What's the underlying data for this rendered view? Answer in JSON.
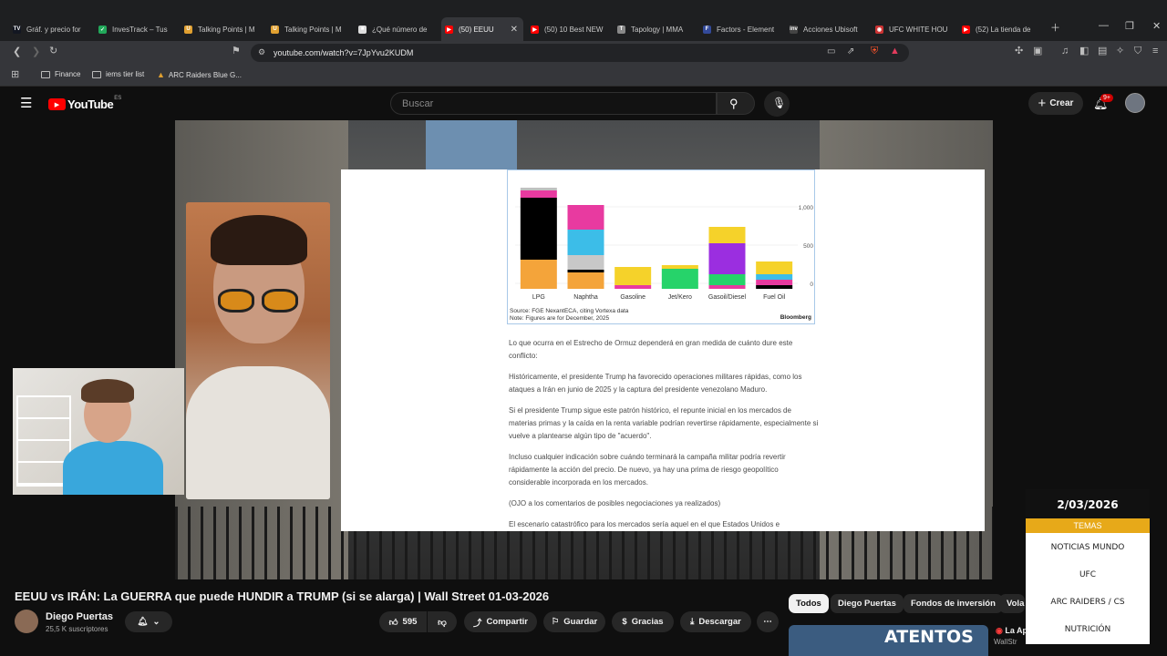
{
  "browser": {
    "tabs": [
      {
        "label": "Gráf. y precio for",
        "color": "#131722",
        "glyph": "TV"
      },
      {
        "label": "InvesTrack – Tus",
        "color": "#22a85a",
        "glyph": "✓"
      },
      {
        "label": "Talking Points | M",
        "color": "#e0a030",
        "glyph": "U"
      },
      {
        "label": "Talking Points | M",
        "color": "#e0a030",
        "glyph": "U"
      },
      {
        "label": "¿Qué número de",
        "color": "#dddddd",
        "glyph": "■"
      },
      {
        "label": "(50) EEUU",
        "color": "#ff0000",
        "glyph": "▶"
      },
      {
        "label": "(50) 10 Best NEW",
        "color": "#ff0000",
        "glyph": "▶"
      },
      {
        "label": "Tapology | MMA",
        "color": "#888888",
        "glyph": "T"
      },
      {
        "label": "Factors - Element",
        "color": "#334a9a",
        "glyph": "F"
      },
      {
        "label": "Acciones Ubisoft",
        "color": "#444444",
        "glyph": "inv"
      },
      {
        "label": "UFC WHITE HOU",
        "color": "#cc3333",
        "glyph": "◉"
      },
      {
        "label": "(52) La tienda de",
        "color": "#ff0000",
        "glyph": "▶"
      }
    ],
    "url": "youtube.com/watch?v=7JpYvu2KUDM",
    "bookmarks": [
      "Finance",
      "iems tier list",
      "ARC Raiders Blue G..."
    ]
  },
  "youtube": {
    "logo_text": "YouTube",
    "region": "ES",
    "search_placeholder": "Buscar",
    "create_label": "Crear",
    "notifications_badge": "9+"
  },
  "video": {
    "chart": {
      "categories": [
        "LPG",
        "Naphtha",
        "Gasoline",
        "Jet/Kero",
        "Gasoil/Diesel",
        "Fuel Oil"
      ],
      "y_ticks": [
        "1,000",
        "500",
        "0"
      ],
      "source": "Source: FGE NexantECA, citing Vortexa data",
      "note": "Note: Figures are for December, 2025",
      "brand": "Bloomberg"
    },
    "paragraphs": [
      "Lo que ocurra en el Estrecho de Ormuz dependerá en gran medida de cuánto dure este conflicto:",
      "Históricamente, el presidente Trump ha favorecido operaciones militares rápidas, como los ataques a Irán en junio de 2025 y la captura del presidente venezolano Maduro.",
      "Si el presidente Trump sigue este patrón histórico, el repunte inicial en los mercados de materias primas y la caída en la renta variable podrían revertirse rápidamente, especialmente si vuelve a plantearse algún tipo de \"acuerdo\".",
      "Incluso cualquier indicación sobre cuándo terminará la campaña militar podría revertir rápidamente la acción del precio. De nuevo, ya hay una prima de riesgo geopolítico considerable incorporada en los mercados.",
      "(OJO a los comentarios de posibles negociaciones ya realizados)",
      "El escenario catastrófico para los mercados sería aquel en el que Estados Unidos e"
    ],
    "overlay": {
      "date": "2/03/2026",
      "temas": "TEMAS",
      "topics": [
        "NOTICIAS MUNDO",
        "UFC",
        "ARC RAIDERS / CS",
        "NUTRICIÓN"
      ]
    }
  },
  "meta": {
    "title": "EEUU vs IRÁN: La GUERRA que puede HUNDIR a TRUMP (si se alarga) | Wall Street 01-03-2026",
    "channel": "Diego Puertas",
    "subscribers": "25,5 K suscriptores",
    "likes": "595",
    "share": "Compartir",
    "save": "Guardar",
    "thanks": "Gracias",
    "download": "Descargar"
  },
  "chips": [
    "Todos",
    "Diego Puertas",
    "Fondos de inversión",
    "Vola"
  ],
  "sidebar_preview": {
    "thumb_text": "ATENTOS",
    "title": "La Ap",
    "subtitle": "WallStr"
  }
}
